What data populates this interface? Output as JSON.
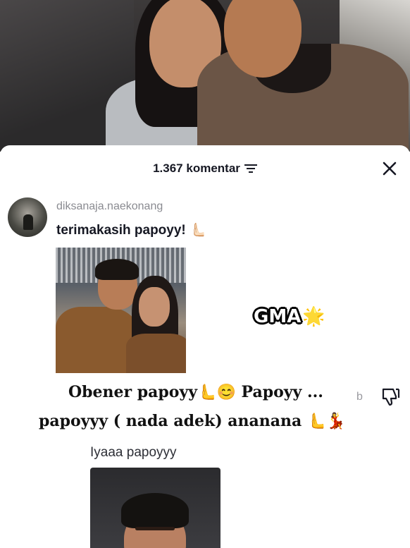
{
  "sheet": {
    "comment_count": "1.367 komentar",
    "filter_icon": "filter-icon",
    "close_icon": "close-icon"
  },
  "comment": {
    "username": "diksanaja.naekonang",
    "text": "terimakasih papoyy! 🫷🏻",
    "image_description_icon": "photo-attachment"
  },
  "overlay": {
    "sticker_text": "GMA",
    "sticker_emoji": "🌟",
    "caption_line1": "Obener papoyy🫷😊 Papoyy ...",
    "caption_line2": "papoyyy ( nada adek) ananana 🫷💃"
  },
  "side": {
    "ghost_text": "b"
  },
  "reply": {
    "text": "Iyaaa papoyyy"
  },
  "colors": {
    "text_primary": "#161823",
    "text_secondary": "#8a8b91",
    "background": "#ffffff"
  }
}
